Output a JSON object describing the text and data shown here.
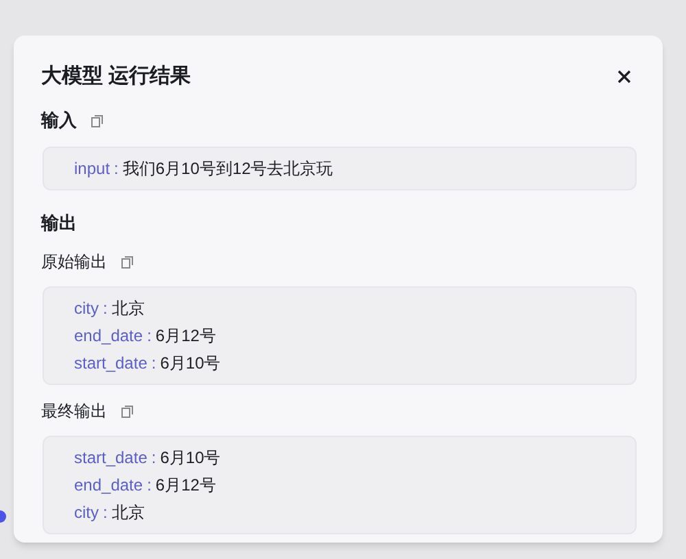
{
  "dialog": {
    "title": "大模型 运行结果"
  },
  "input": {
    "label": "输入",
    "fields": [
      {
        "key": "input",
        "separator": ":",
        "value": "我们6月10号到12号去北京玩"
      }
    ]
  },
  "output": {
    "heading": "输出",
    "sections": [
      {
        "label": "原始输出",
        "fields": [
          {
            "key": "city",
            "separator": ":",
            "value": "北京"
          },
          {
            "key": "end_date",
            "separator": ":",
            "value": "6月12号"
          },
          {
            "key": "start_date",
            "separator": ":",
            "value": "6月10号"
          }
        ]
      },
      {
        "label": "最终输出",
        "fields": [
          {
            "key": "start_date",
            "separator": ":",
            "value": "6月10号"
          },
          {
            "key": "end_date",
            "separator": ":",
            "value": "6月12号"
          },
          {
            "key": "city",
            "separator": ":",
            "value": "北京"
          }
        ]
      }
    ]
  }
}
